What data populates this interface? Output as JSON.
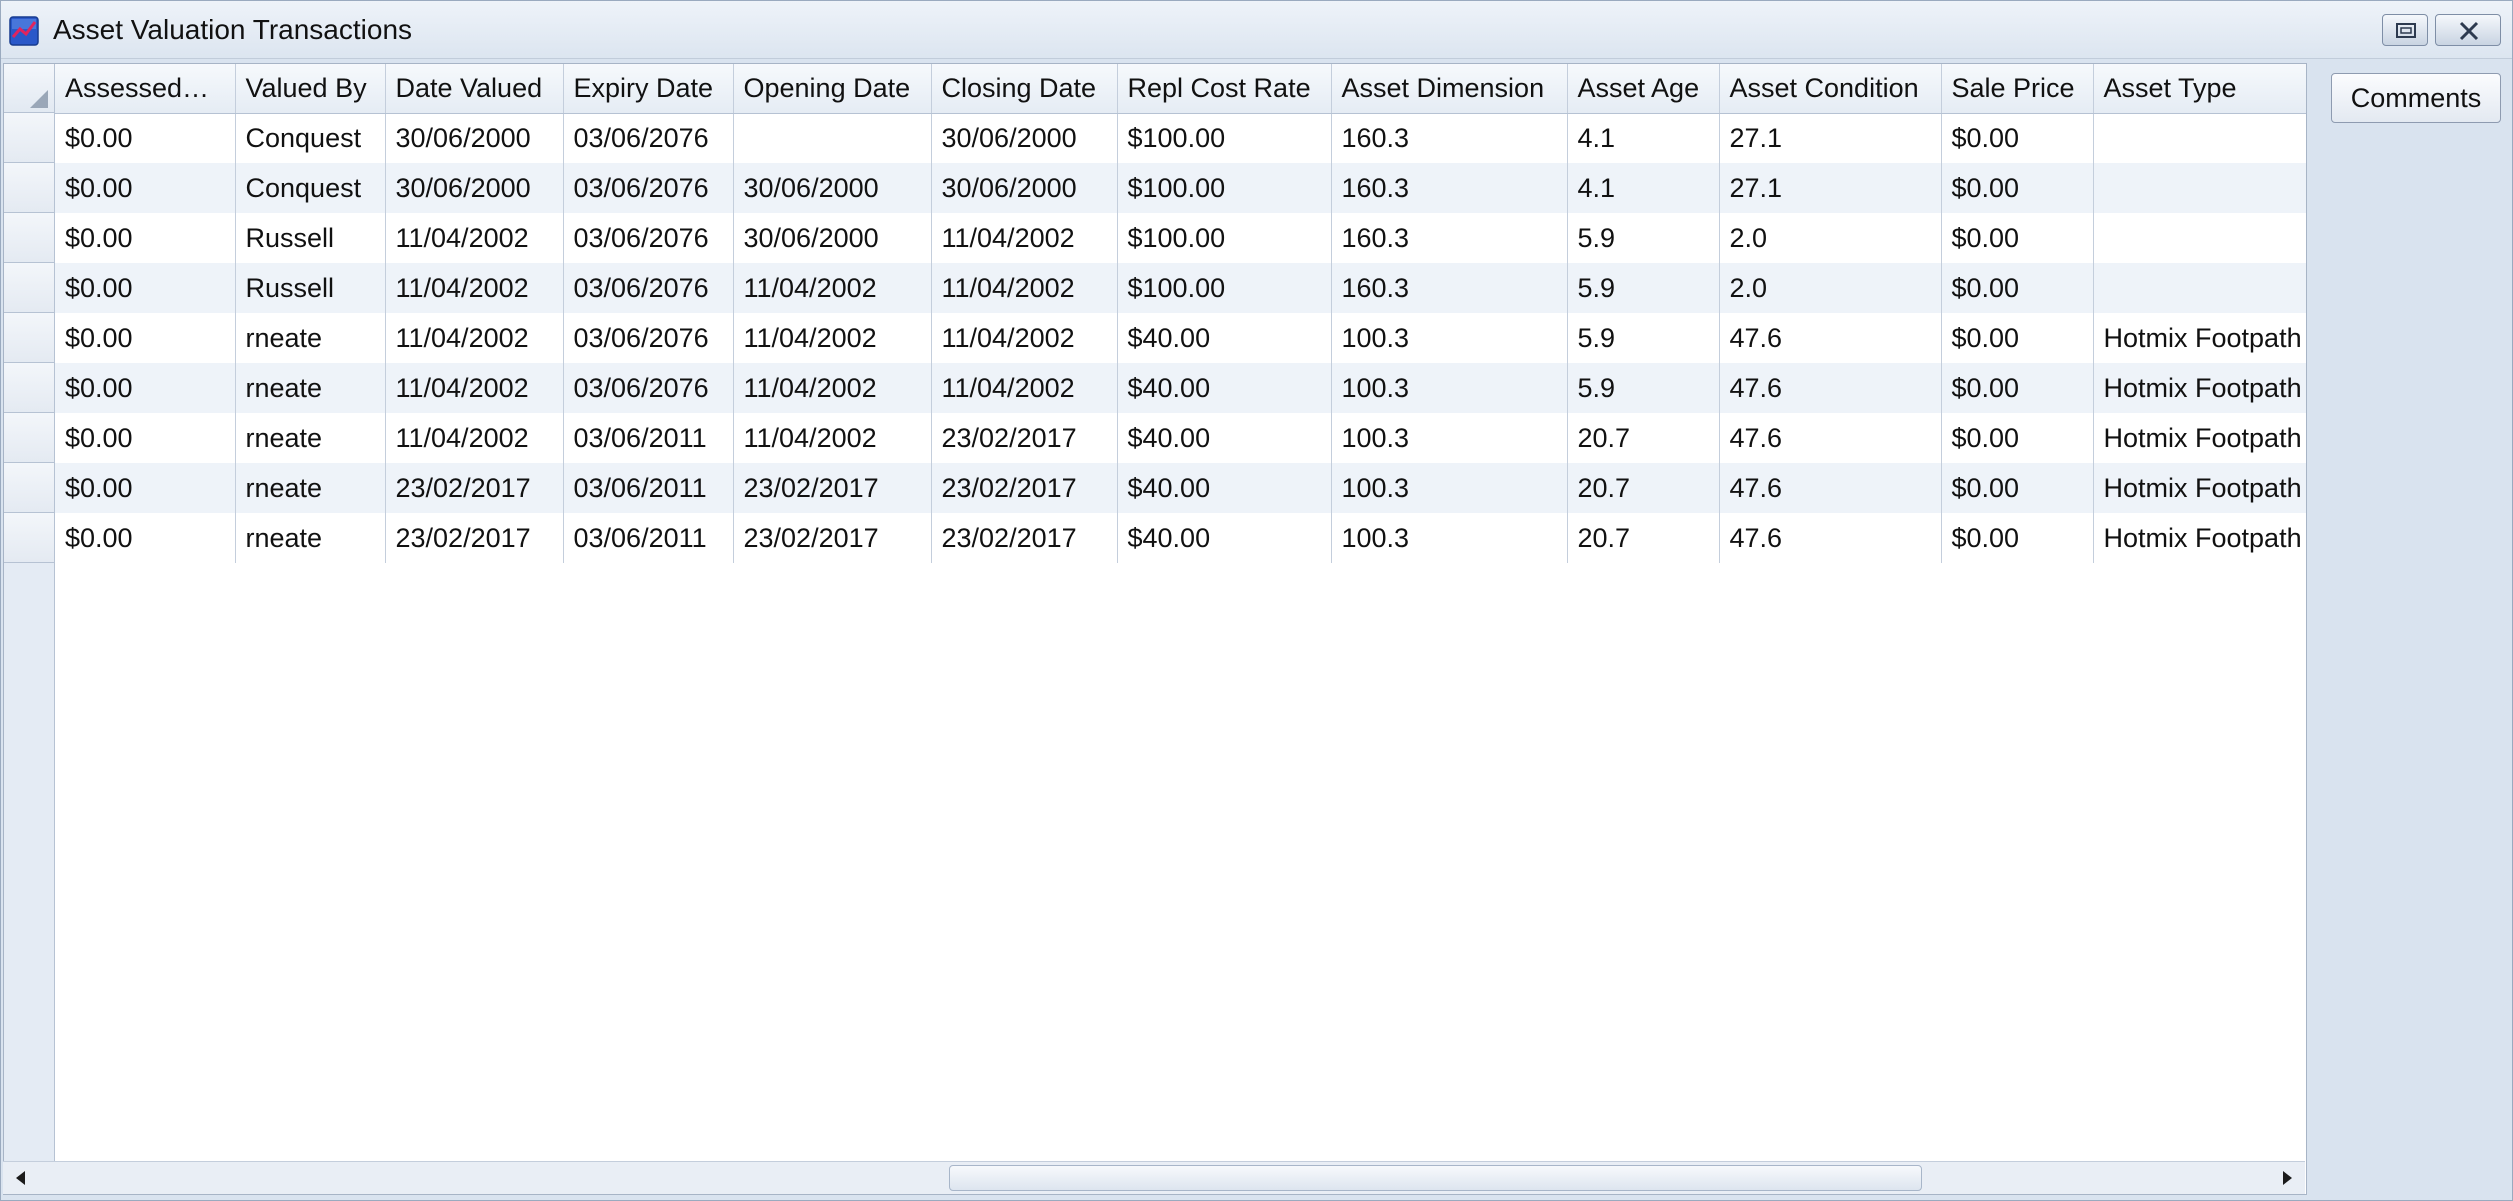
{
  "window": {
    "title": "Asset Valuation Transactions"
  },
  "side_panel": {
    "comments_label": "Comments"
  },
  "grid": {
    "columns": [
      "Assessed…",
      "Valued By",
      "Date Valued",
      "Expiry Date",
      "Opening Date",
      "Closing Date",
      "Repl Cost Rate",
      "Asset Dimension",
      "Asset Age",
      "Asset Condition",
      "Sale Price",
      "Asset Type"
    ],
    "rows": [
      [
        "$0.00",
        "Conquest",
        "30/06/2000",
        "03/06/2076",
        "",
        "30/06/2000",
        "$100.00",
        "160.3",
        "4.1",
        "27.1",
        "$0.00",
        ""
      ],
      [
        "$0.00",
        "Conquest",
        "30/06/2000",
        "03/06/2076",
        "30/06/2000",
        "30/06/2000",
        "$100.00",
        "160.3",
        "4.1",
        "27.1",
        "$0.00",
        ""
      ],
      [
        "$0.00",
        "Russell",
        "11/04/2002",
        "03/06/2076",
        "30/06/2000",
        "11/04/2002",
        "$100.00",
        "160.3",
        "5.9",
        "2.0",
        "$0.00",
        ""
      ],
      [
        "$0.00",
        "Russell",
        "11/04/2002",
        "03/06/2076",
        "11/04/2002",
        "11/04/2002",
        "$100.00",
        "160.3",
        "5.9",
        "2.0",
        "$0.00",
        ""
      ],
      [
        "$0.00",
        "rneate",
        "11/04/2002",
        "03/06/2076",
        "11/04/2002",
        "11/04/2002",
        "$40.00",
        "100.3",
        "5.9",
        "47.6",
        "$0.00",
        "Hotmix Footpath"
      ],
      [
        "$0.00",
        "rneate",
        "11/04/2002",
        "03/06/2076",
        "11/04/2002",
        "11/04/2002",
        "$40.00",
        "100.3",
        "5.9",
        "47.6",
        "$0.00",
        "Hotmix Footpath"
      ],
      [
        "$0.00",
        "rneate",
        "11/04/2002",
        "03/06/2011",
        "11/04/2002",
        "23/02/2017",
        "$40.00",
        "100.3",
        "20.7",
        "47.6",
        "$0.00",
        "Hotmix Footpath"
      ],
      [
        "$0.00",
        "rneate",
        "23/02/2017",
        "03/06/2011",
        "23/02/2017",
        "23/02/2017",
        "$40.00",
        "100.3",
        "20.7",
        "47.6",
        "$0.00",
        "Hotmix Footpath"
      ],
      [
        "$0.00",
        "rneate",
        "23/02/2017",
        "03/06/2011",
        "23/02/2017",
        "23/02/2017",
        "$40.00",
        "100.3",
        "20.7",
        "47.6",
        "$0.00",
        "Hotmix Footpath"
      ]
    ]
  },
  "colors": {
    "window_bg": "#d9e3ef",
    "row_alt": "#eef3f9",
    "grid_line": "#c4cedc"
  },
  "icons": {
    "app": "app-chart-icon",
    "restore": "restore-icon",
    "close": "close-icon",
    "scroll_left": "arrow-left-icon",
    "scroll_right": "arrow-right-icon",
    "select_all": "select-all-triangle-icon"
  }
}
